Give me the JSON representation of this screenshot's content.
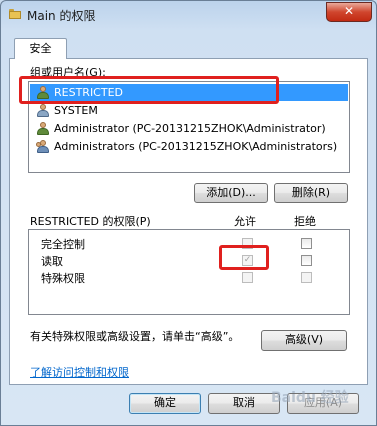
{
  "window": {
    "title": "Main 的权限",
    "close_glyph": "✕"
  },
  "tabs": [
    {
      "label": "安全"
    }
  ],
  "group_section": {
    "label": "组或用户名(G):",
    "items": [
      {
        "name": "RESTRICTED",
        "icon": "user-icon",
        "selected": true
      },
      {
        "name": "SYSTEM",
        "icon": "system-user-icon",
        "selected": false
      },
      {
        "name": "Administrator (PC-20131215ZHOK\\Administrator)",
        "icon": "user-icon",
        "selected": false
      },
      {
        "name": "Administrators (PC-20131215ZHOK\\Administrators)",
        "icon": "group-icon",
        "selected": false
      }
    ],
    "add_button": "添加(D)...",
    "remove_button": "删除(R)"
  },
  "permissions": {
    "header_label": "RESTRICTED 的权限(P)",
    "allow_header": "允许",
    "deny_header": "拒绝",
    "rows": [
      {
        "name": "完全控制",
        "allow": false,
        "deny": false
      },
      {
        "name": "读取",
        "allow": true,
        "deny": false
      },
      {
        "name": "特殊权限",
        "allow": false,
        "deny": false
      }
    ]
  },
  "advanced": {
    "text": "有关特殊权限或高级设置，请单击“高级”。",
    "button": "高级(V)"
  },
  "help_link": "了解访问控制和权限",
  "footer": {
    "ok": "确定",
    "cancel": "取消",
    "apply": "应用(A)"
  },
  "watermark": "Baidu 经验",
  "accent_colors": {
    "selection": "#3399ff",
    "highlight_box": "#e0201e",
    "link": "#0066cc"
  }
}
